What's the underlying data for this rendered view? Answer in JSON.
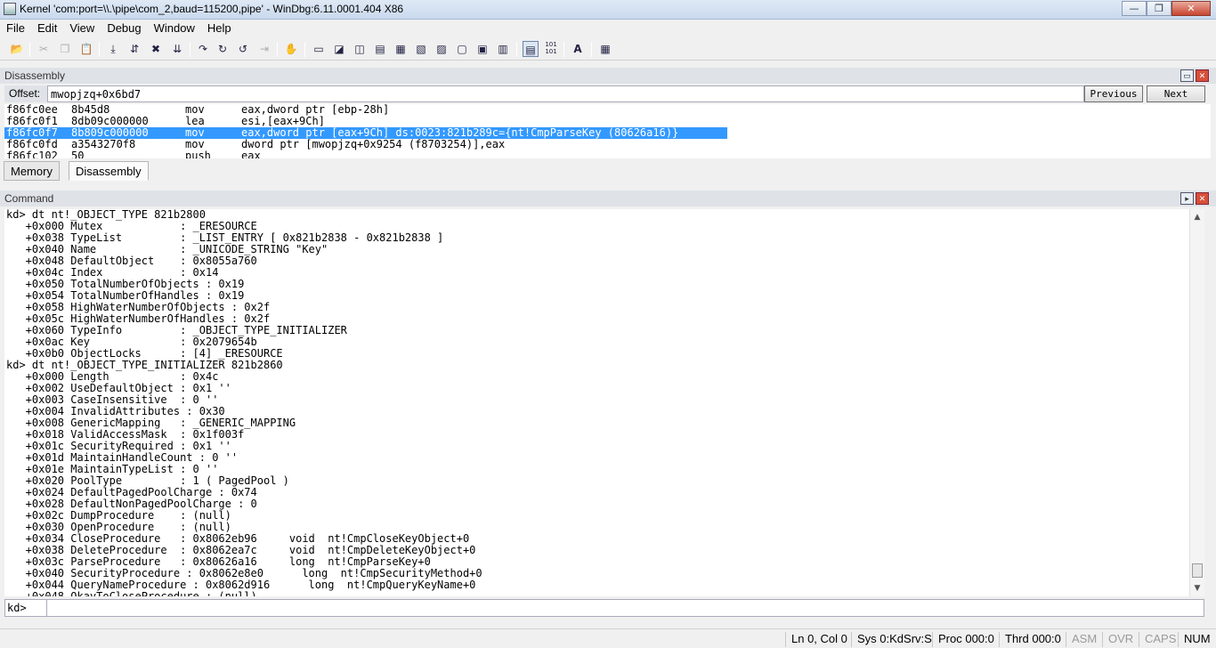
{
  "window": {
    "title": "Kernel 'com:port=\\\\.\\pipe\\com_2,baud=115200,pipe' - WinDbg:6.11.0001.404 X86",
    "minimize": "—",
    "maximize": "❐",
    "close": "✕"
  },
  "menu": [
    "File",
    "Edit",
    "View",
    "Debug",
    "Window",
    "Help"
  ],
  "toolbar": {
    "icons": [
      "open-icon",
      "cut-icon",
      "copy-icon",
      "paste-icon",
      "go-icon",
      "restart-icon",
      "stop-debugging-icon",
      "break-icon",
      "step-into-icon",
      "step-over-icon",
      "step-out-icon",
      "run-to-cursor-icon",
      "breakpoint-hand-icon",
      "command-window-icon",
      "watch-icon",
      "locals-icon",
      "registers-icon",
      "memory-icon",
      "call-stack-icon",
      "disassembly-icon",
      "scratch-pad-icon",
      "source-mode-icon",
      "hex-mode-icon",
      "font-icon",
      "options-icon"
    ],
    "glyphs": {
      "hex": "101\n101",
      "font": "A"
    }
  },
  "disassembly": {
    "title": "Disassembly",
    "offset_label": "Offset:",
    "offset_value": "mwopjzq+0x6bd7",
    "previous": "Previous",
    "next": "Next",
    "lines": [
      {
        "addr": "f86fc0ee",
        "bytes": "8b45d8",
        "op": "mov",
        "args": "eax,dword ptr [ebp-28h]"
      },
      {
        "addr": "f86fc0f1",
        "bytes": "8db09c000000",
        "op": "lea",
        "args": "esi,[eax+9Ch]"
      },
      {
        "addr": "f86fc0f7",
        "bytes": "8b809c000000",
        "op": "mov",
        "args": "eax,dword ptr [eax+9Ch] ds:0023:821b289c={nt!CmpParseKey (80626a16)}",
        "selected": true
      },
      {
        "addr": "f86fc0fd",
        "bytes": "a3543270f8",
        "op": "mov",
        "args": "dword ptr [mwopjzq+0x9254 (f8703254)],eax"
      },
      {
        "addr": "f86fc102",
        "bytes": "50",
        "op": "push",
        "args": "eax"
      }
    ]
  },
  "tabs": [
    "Memory",
    "Disassembly"
  ],
  "command": {
    "title": "Command",
    "prompt": "kd>",
    "input_value": "",
    "lines": [
      "kd> dt nt!_OBJECT_TYPE 821b2800",
      "   +0x000 Mutex            : _ERESOURCE",
      "   +0x038 TypeList         : _LIST_ENTRY [ 0x821b2838 - 0x821b2838 ]",
      "   +0x040 Name             : _UNICODE_STRING \"Key\"",
      "   +0x048 DefaultObject    : 0x8055a760",
      "   +0x04c Index            : 0x14",
      "   +0x050 TotalNumberOfObjects : 0x19",
      "   +0x054 TotalNumberOfHandles : 0x19",
      "   +0x058 HighWaterNumberOfObjects : 0x2f",
      "   +0x05c HighWaterNumberOfHandles : 0x2f",
      "   +0x060 TypeInfo         : _OBJECT_TYPE_INITIALIZER",
      "   +0x0ac Key              : 0x2079654b",
      "   +0x0b0 ObjectLocks      : [4] _ERESOURCE",
      "kd> dt nt!_OBJECT_TYPE_INITIALIZER 821b2860",
      "   +0x000 Length           : 0x4c",
      "   +0x002 UseDefaultObject : 0x1 ''",
      "   +0x003 CaseInsensitive  : 0 ''",
      "   +0x004 InvalidAttributes : 0x30",
      "   +0x008 GenericMapping   : _GENERIC_MAPPING",
      "   +0x018 ValidAccessMask  : 0x1f003f",
      "   +0x01c SecurityRequired : 0x1 ''",
      "   +0x01d MaintainHandleCount : 0 ''",
      "   +0x01e MaintainTypeList : 0 ''",
      "   +0x020 PoolType         : 1 ( PagedPool )",
      "   +0x024 DefaultPagedPoolCharge : 0x74",
      "   +0x028 DefaultNonPagedPoolCharge : 0",
      "   +0x02c DumpProcedure    : (null)",
      "   +0x030 OpenProcedure    : (null)",
      "   +0x034 CloseProcedure   : 0x8062eb96     void  nt!CmpCloseKeyObject+0",
      "   +0x038 DeleteProcedure  : 0x8062ea7c     void  nt!CmpDeleteKeyObject+0",
      "   +0x03c ParseProcedure   : 0x80626a16     long  nt!CmpParseKey+0",
      "   +0x040 SecurityProcedure : 0x8062e8e0      long  nt!CmpSecurityMethod+0",
      "   +0x044 QueryNameProcedure : 0x8062d916      long  nt!CmpQueryKeyName+0",
      "   +0x048 OkayToCloseProcedure : (null)"
    ]
  },
  "status": {
    "position": "Ln 0, Col 0",
    "sys": "Sys 0:KdSrv:S",
    "proc": "Proc 000:0",
    "thrd": "Thrd 000:0",
    "asm": "ASM",
    "ovr": "OVR",
    "caps": "CAPS",
    "num": "NUM"
  }
}
